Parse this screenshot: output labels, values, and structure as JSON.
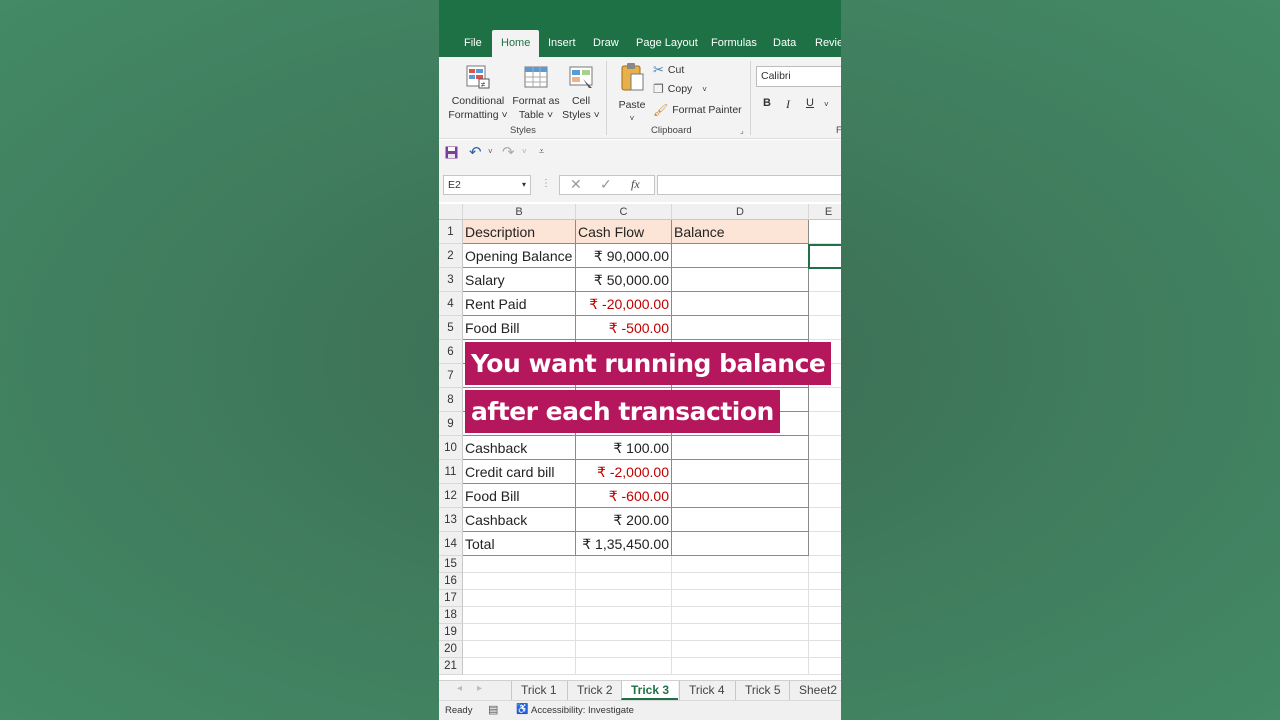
{
  "ribbon_tabs": [
    "File",
    "Home",
    "Insert",
    "Draw",
    "Page Layout",
    "Formulas",
    "Data",
    "Review"
  ],
  "active_ribbon_tab": "Home",
  "ribbon": {
    "conditional_formatting": [
      "Conditional",
      "Formatting ˅"
    ],
    "format_as_table": [
      "Format as",
      "Table ˅"
    ],
    "cell_styles": [
      "Cell",
      "Styles ˅"
    ],
    "styles_group": "Styles",
    "paste": "Paste",
    "cut": "Cut",
    "copy": "Copy",
    "format_painter": "Format Painter",
    "clipboard_group": "Clipboard",
    "font_name": "Calibri",
    "bold": "B",
    "italic": "I",
    "underline": "U"
  },
  "formula_bar": {
    "name_box": "E2",
    "fx": "fx",
    "formula": ""
  },
  "columns": [
    "B",
    "C",
    "D",
    "E"
  ],
  "rows": [
    {
      "n": "1",
      "b": "Description",
      "c": "Cash Flow",
      "d": "Balance",
      "neg": false
    },
    {
      "n": "2",
      "b": "Opening Balance",
      "c": "₹ 90,000.00",
      "d": "",
      "neg": false
    },
    {
      "n": "3",
      "b": "Salary",
      "c": "₹ 50,000.00",
      "d": "",
      "neg": false
    },
    {
      "n": "4",
      "b": "Rent Paid",
      "c": "₹ -20,000.00",
      "d": "",
      "neg": true
    },
    {
      "n": "5",
      "b": "Food Bill",
      "c": "₹ -500.00",
      "d": "",
      "neg": true
    },
    {
      "n": "6",
      "b": "",
      "c": "",
      "d": "",
      "neg": false
    },
    {
      "n": "7",
      "b": "",
      "c": "",
      "d": "",
      "neg": false
    },
    {
      "n": "8",
      "b": "",
      "c": "",
      "d": "",
      "neg": false
    },
    {
      "n": "9",
      "b": "",
      "c": "",
      "d": "",
      "neg": false
    },
    {
      "n": "10",
      "b": "Cashback",
      "c": "₹ 100.00",
      "d": "",
      "neg": false
    },
    {
      "n": "11",
      "b": "Credit card bill",
      "c": "₹ -2,000.00",
      "d": "",
      "neg": true
    },
    {
      "n": "12",
      "b": "Food Bill",
      "c": "₹ -600.00",
      "d": "",
      "neg": true
    },
    {
      "n": "13",
      "b": "Cashback",
      "c": "₹ 200.00",
      "d": "",
      "neg": false
    },
    {
      "n": "14",
      "b": "Total",
      "c": "₹ 1,35,450.00",
      "d": "",
      "neg": false
    }
  ],
  "empty_rows": [
    "15",
    "16",
    "17",
    "18",
    "19",
    "20",
    "21"
  ],
  "overlay_text": [
    "You want running balance",
    "after each transaction"
  ],
  "sheet_tabs": [
    "Trick 1",
    "Trick 2",
    "Trick 3",
    "Trick 4",
    "Trick 5",
    "Sheet2"
  ],
  "active_sheet": "Trick 3",
  "status": {
    "ready": "Ready",
    "accessibility": "Accessibility: Investigate"
  },
  "colors": {
    "excel_green": "#1e7145",
    "header_fill": "#fce4d6",
    "negative": "#c00000",
    "banner": "#b5175c"
  }
}
